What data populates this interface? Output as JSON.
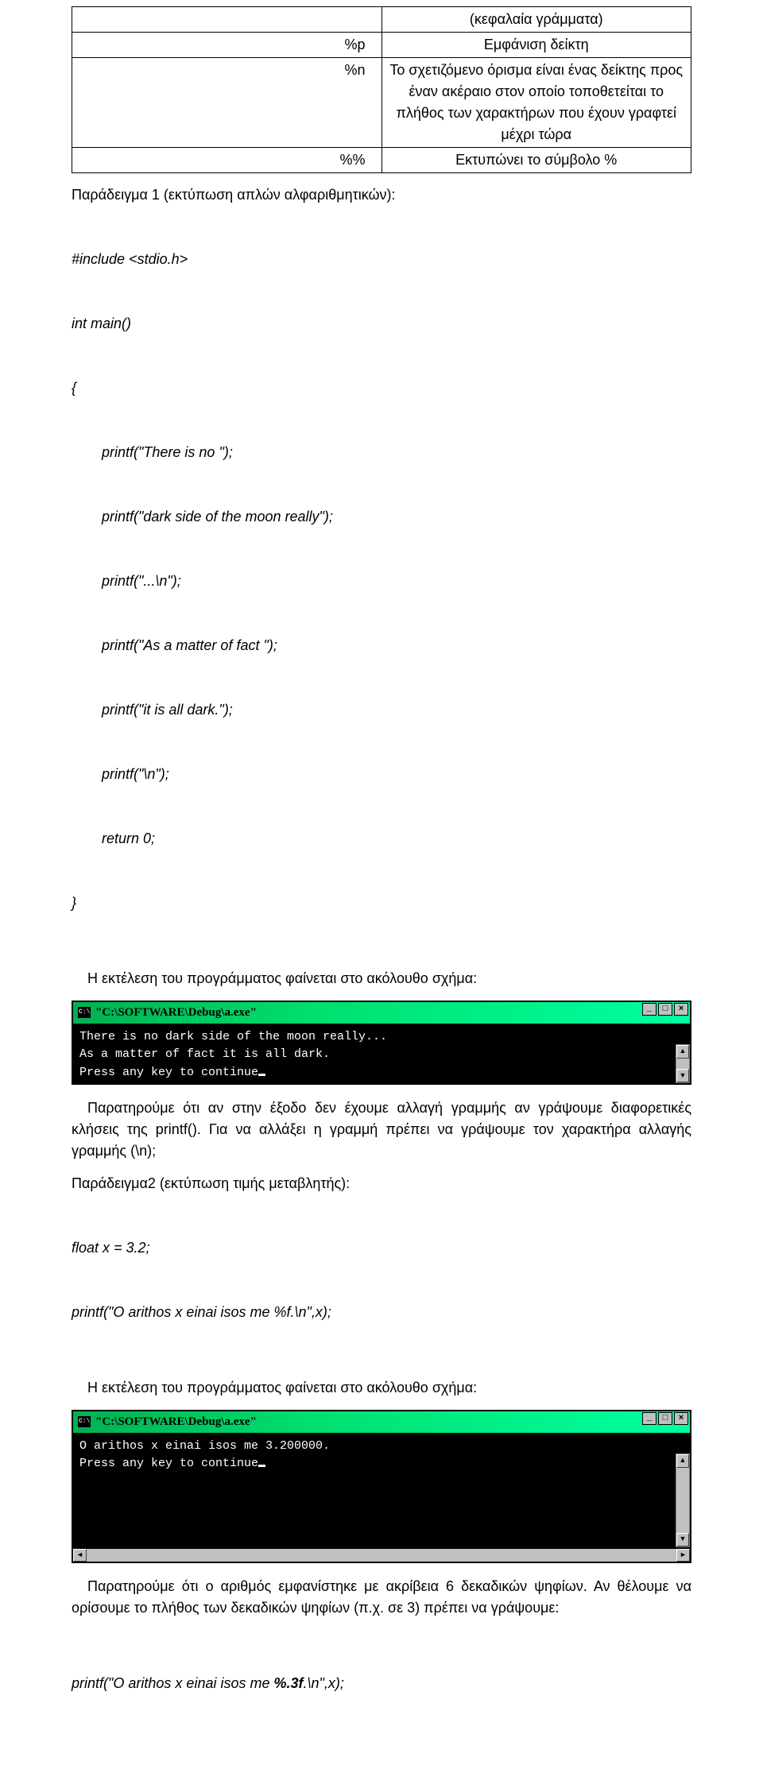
{
  "table": {
    "r0": {
      "l": "",
      "r": "(κεφαλαία γράμματα)"
    },
    "r1": {
      "l": "%p",
      "r": "Εμφάνιση δείκτη"
    },
    "r2": {
      "l": "%n",
      "r": "Το σχετιζόμενο όρισμα είναι ένας δείκτης προς έναν ακέραιο στον οποίο τοποθετείται το πλήθος των χαρακτήρων που έχουν γραφτεί μέχρι τώρα"
    },
    "r3": {
      "l": "%%",
      "r": "Εκτυπώνει το σύμβολο %"
    }
  },
  "ex1": {
    "title": "Παράδειγμα 1 (εκτύπωση απλών αλφαριθμητικών):",
    "c0": "#include <stdio.h>",
    "c1": "int main()",
    "c2": "{",
    "c3": "printf(\"There is no \");",
    "c4": "printf(\"dark side of the moon really\");",
    "c5": "printf(\"...\\n\");",
    "c6": "printf(\"As a matter of fact \");",
    "c7": "printf(\"it is all dark.\");",
    "c8": "printf(\"\\n\");",
    "c9": "return 0;",
    "c10": "}"
  },
  "p_exec": "Η εκτέλεση του προγράμματος φαίνεται στο ακόλουθο σχήμα:",
  "term1": {
    "title": "\"C:\\SOFTWARE\\Debug\\a.exe\"",
    "l0": "There is no dark side of the moon really...",
    "l1": "As a matter of fact it is all dark.",
    "l2": "Press any key to continue"
  },
  "p_observe1": "Παρατηρούμε ότι αν στην έξοδο δεν έχουμε αλλαγή γραμμής αν γράψουμε διαφορετικές κλήσεις της printf(). Για να αλλάξει η γραμμή πρέπει να γράψουμε τον χαρακτήρα αλλαγής γραμμής (\\n);",
  "ex2": {
    "title": "Παράδειγμα2 (εκτύπωση τιμής μεταβλητής):",
    "c0": "float x = 3.2;",
    "c1": "printf(\"O arithos x einai isos me %f.\\n\",x);"
  },
  "term2": {
    "title": "\"C:\\SOFTWARE\\Debug\\a.exe\"",
    "l0": "O arithos x einai isos me 3.200000.",
    "l1": "Press any key to continue"
  },
  "p_observe2": "Παρατηρούμε ότι ο αριθμός εμφανίστηκε με ακρίβεια 6 δεκαδικών ψηφίων. Αν θέλουμε να ορίσουμε το πλήθος των δεκαδικών ψηφίων (π.χ. σε 3) πρέπει να γράψουμε:",
  "ex3": {
    "c0": "printf(\"O arithos x einai isos me %.3f.\\n\",x);"
  },
  "btn": {
    "min": "_",
    "max": "□",
    "close": "×",
    "up": "▲",
    "down": "▼",
    "left": "◄",
    "right": "►"
  }
}
